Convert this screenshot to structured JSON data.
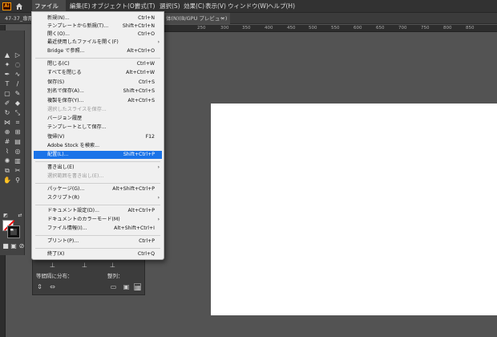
{
  "menubar": {
    "app_logo": "Ai",
    "items": [
      "ファイル(F)",
      "編集(E)",
      "オブジェクト(O)",
      "書式(T)",
      "選択(S)",
      "効果(C)",
      "表示(V)",
      "ウィンドウ(W)",
      "ヘルプ(H)"
    ]
  },
  "tabs": [
    "47-37_専用_ai",
    "体(N)(B/GPU プレビュー)",
    "×"
  ],
  "ruler": [
    "250",
    "300",
    "350",
    "400",
    "450",
    "500",
    "550",
    "600",
    "650",
    "700",
    "750",
    "800",
    "850"
  ],
  "file_menu": {
    "items": [
      {
        "label": "新規(N)...",
        "shortcut": "Ctrl+N"
      },
      {
        "label": "テンプレートから新規(T)...",
        "shortcut": "Shift+Ctrl+N"
      },
      {
        "label": "開く(O)...",
        "shortcut": "Ctrl+O"
      },
      {
        "label": "最近使用したファイルを開く(F)",
        "submenu": "›"
      },
      {
        "label": "Bridge で参照...",
        "shortcut": "Alt+Ctrl+O"
      },
      {
        "label": "閉じる(C)",
        "shortcut": "Ctrl+W"
      },
      {
        "label": "すべてを閉じる",
        "shortcut": "Alt+Ctrl+W"
      },
      {
        "label": "保存(S)",
        "shortcut": "Ctrl+S"
      },
      {
        "label": "別名で保存(A)...",
        "shortcut": "Shift+Ctrl+S"
      },
      {
        "label": "複製を保存(Y)...",
        "shortcut": "Alt+Ctrl+S"
      },
      {
        "label": "選択したスライスを保存...",
        "disabled": true
      },
      {
        "label": "バージョン履歴"
      },
      {
        "label": "テンプレートとして保存..."
      },
      {
        "label": "復帰(V)",
        "shortcut": "F12"
      },
      {
        "label": "Adobe Stock を検索..."
      },
      {
        "label": "配置(L)...",
        "shortcut": "Shift+Ctrl+P",
        "selected": true
      },
      {
        "label": "書き出し(E)",
        "submenu": "›"
      },
      {
        "label": "選択範囲を書き出し(E)...",
        "disabled": true
      },
      {
        "label": "パッケージ(G)...",
        "shortcut": "Alt+Shift+Ctrl+P"
      },
      {
        "label": "スクリプト(R)",
        "submenu": "›"
      },
      {
        "label": "ドキュメント設定(D)...",
        "shortcut": "Alt+Ctrl+P"
      },
      {
        "label": "ドキュメントのカラーモード(M)",
        "submenu": "›"
      },
      {
        "label": "ファイル情報(I)...",
        "shortcut": "Alt+Shift+Ctrl+I"
      },
      {
        "label": "プリント(P)...",
        "shortcut": "Ctrl+P"
      },
      {
        "label": "終了(X)",
        "shortcut": "Ctrl+Q"
      }
    ]
  },
  "panel": {
    "left_label": "等間隔に分布：",
    "right_label": "整列："
  },
  "colors": {
    "menu_bg": "#f0f0f0",
    "highlight": "#1a73e8",
    "ui_dark": "#535353"
  }
}
